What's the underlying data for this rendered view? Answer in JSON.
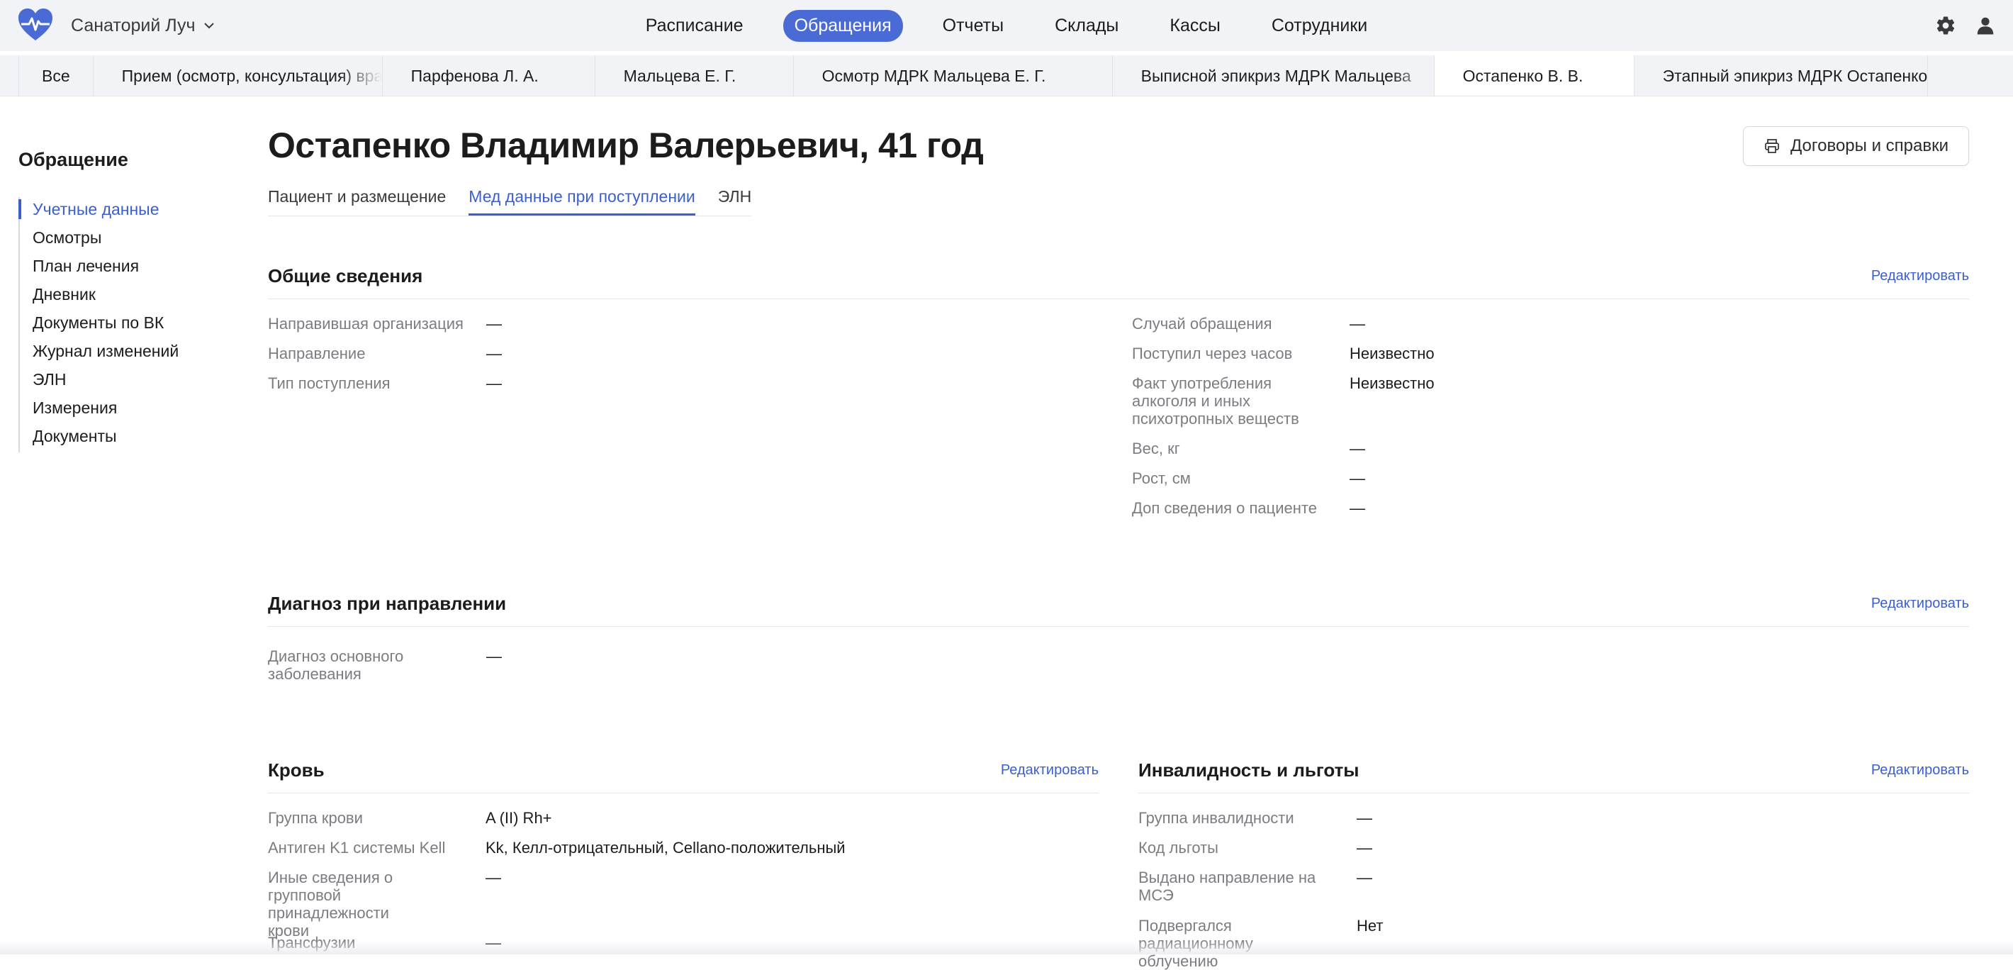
{
  "header": {
    "org_name": "Санаторий Луч",
    "nav": [
      "Расписание",
      "Обращения",
      "Отчеты",
      "Склады",
      "Кассы",
      "Сотрудники"
    ],
    "active_nav": "Обращения"
  },
  "tabs": [
    "Все",
    "Прием (осмотр, консультация) врача",
    "Парфенова Л. А.",
    "Мальцева Е. Г.",
    "Осмотр МДРК Мальцева Е. Г.",
    "Выписной эпикриз МДРК Мальцева",
    "Остапенко В. В.",
    "Этапный эпикриз МДРК Остапенко"
  ],
  "sidebar": {
    "title": "Обращение",
    "items": [
      "Учетные данные",
      "Осмотры",
      "План лечения",
      "Дневник",
      "Документы по ВК",
      "Журнал изменений",
      "ЭЛН",
      "Измерения",
      "Документы"
    ]
  },
  "page": {
    "title": "Остапенко Владимир Валерьевич, 41 год",
    "print_button": "Договоры и справки",
    "subtabs": [
      "Пациент и размещение",
      "Мед данные при поступлении",
      "ЭЛН"
    ]
  },
  "edit_label": "Редактировать",
  "general": {
    "title": "Общие сведения",
    "left": [
      {
        "label": "Направившая организация",
        "value": "—"
      },
      {
        "label": "Направление",
        "value": "—"
      },
      {
        "label": "Тип поступления",
        "value": "—"
      }
    ],
    "right": [
      {
        "label": "Случай обращения",
        "value": "—"
      },
      {
        "label": "Поступил через часов",
        "value": "Неизвестно"
      },
      {
        "label": "Факт употребления алкоголя и иных психотропных веществ",
        "value": "Неизвестно"
      },
      {
        "label": "Вес, кг",
        "value": "—"
      },
      {
        "label": "Рост, см",
        "value": "—"
      },
      {
        "label": "Доп сведения о пациенте",
        "value": "—"
      }
    ]
  },
  "diagnosis": {
    "title": "Диагноз при направлении",
    "fields": [
      {
        "label": "Диагноз основного заболевания",
        "value": "—"
      }
    ]
  },
  "blood": {
    "title": "Кровь",
    "fields": [
      {
        "label": "Группа крови",
        "value": "A (II) Rh+"
      },
      {
        "label": "Антиген K1 системы Kell",
        "value": "Kk, Келл-отрицательный, Cellano-положительный"
      },
      {
        "label": "Иные сведения о групповой принадлежности крови",
        "value": "—"
      },
      {
        "label": "Трансфузии",
        "value": "—"
      }
    ]
  },
  "disability": {
    "title": "Инвалидность и льготы",
    "fields": [
      {
        "label": "Группа инвалидности",
        "value": "—"
      },
      {
        "label": "Код льготы",
        "value": "—"
      },
      {
        "label": "Выдано направление на МСЭ",
        "value": "—"
      },
      {
        "label": "Подвергался радиационному облучению",
        "value": "Нет"
      }
    ]
  },
  "colors": {
    "accent": "#4a6bd6",
    "link": "#3c5fd0",
    "muted": "#7c7c82",
    "bar": "#f2f3f6"
  }
}
